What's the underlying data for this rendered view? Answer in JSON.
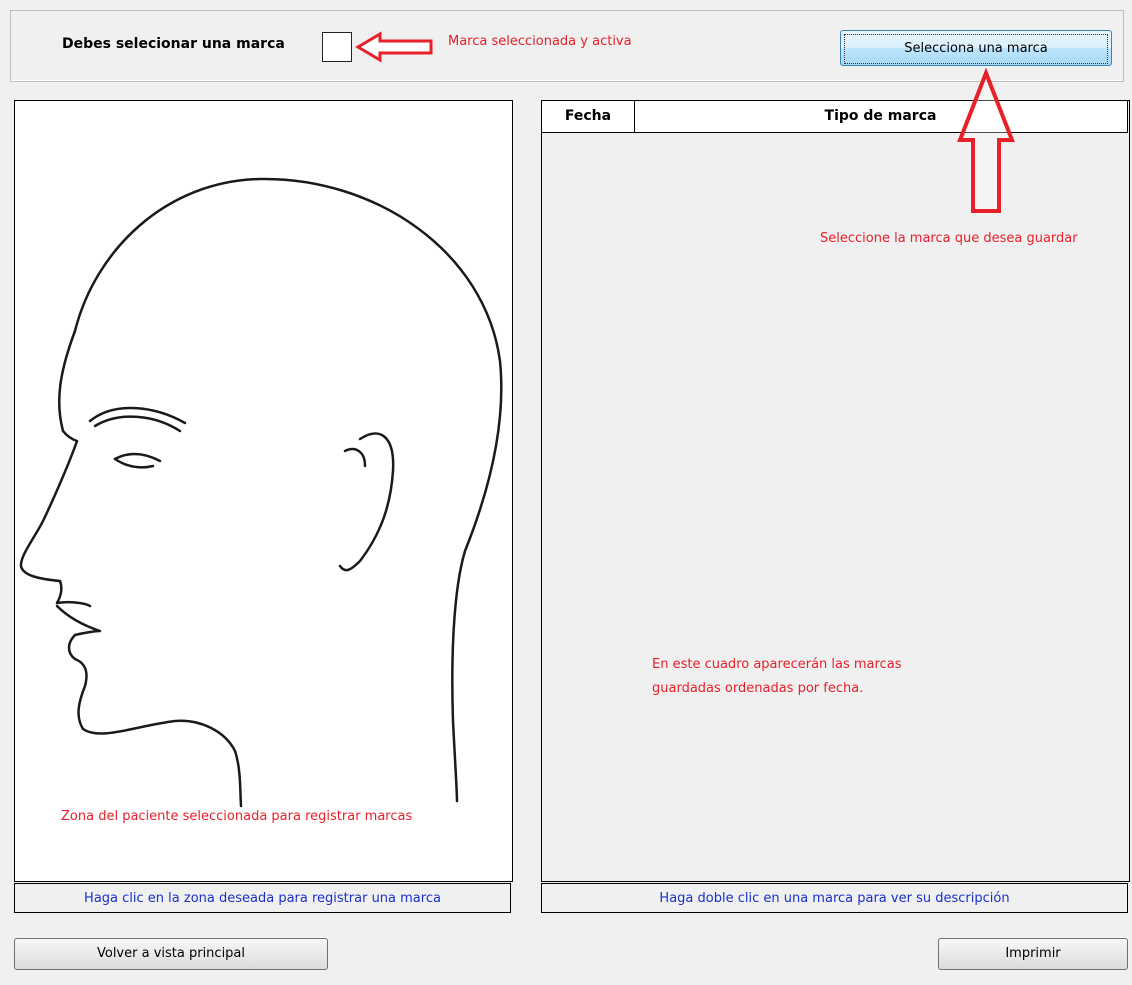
{
  "header": {
    "prompt": "Debes selecionar una marca",
    "select_button": "Selecciona una marca"
  },
  "annotations": {
    "active_mark": "Marca seleccionada y activa",
    "select_mark_to_save": "Seleccione la marca que desea guardar",
    "patient_zone": "Zona del paciente seleccionada para registrar marcas",
    "marks_list_line1": "En este cuadro aparecerán las marcas",
    "marks_list_line2": "guardadas ordenadas por fecha."
  },
  "left_panel": {
    "caption": "Haga clic en la zona deseada para registrar una marca"
  },
  "right_panel": {
    "columns": [
      "Fecha",
      "Tipo de marca"
    ],
    "caption": "Haga doble clic en una marca para ver su descripción"
  },
  "footer": {
    "back_button": "Volver a vista principal",
    "print_button": "Imprimir"
  },
  "colors": {
    "annotation": "#e8202a",
    "caption_text": "#1a2fcc",
    "background": "#f0f0f0"
  },
  "icons": [
    "head-profile-illustration",
    "arrow-left-icon",
    "arrow-up-icon"
  ]
}
